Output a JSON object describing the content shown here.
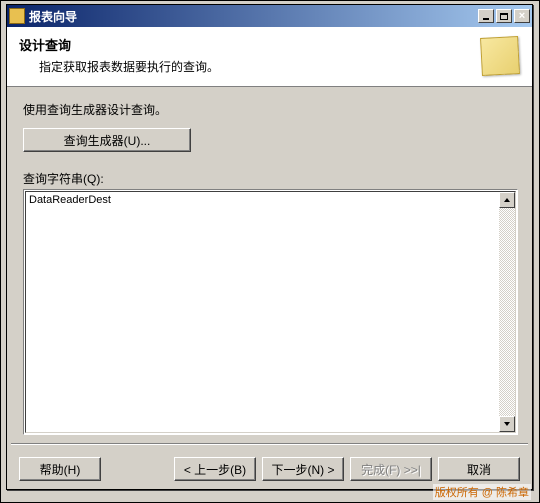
{
  "window": {
    "title": "报表向导"
  },
  "header": {
    "title": "设计查询",
    "subtitle": "指定获取报表数据要执行的查询。"
  },
  "body": {
    "instruction": "使用查询生成器设计查询。",
    "query_builder_btn": "查询生成器(U)...",
    "query_label": "查询字符串(Q):",
    "query_value": "DataReaderDest"
  },
  "footer": {
    "help": "帮助(H)",
    "back": "< 上一步(B)",
    "next": "下一步(N) >",
    "finish": "完成(F) >>|",
    "cancel": "取消"
  },
  "copyright": "版权所有 @ 陈希章"
}
